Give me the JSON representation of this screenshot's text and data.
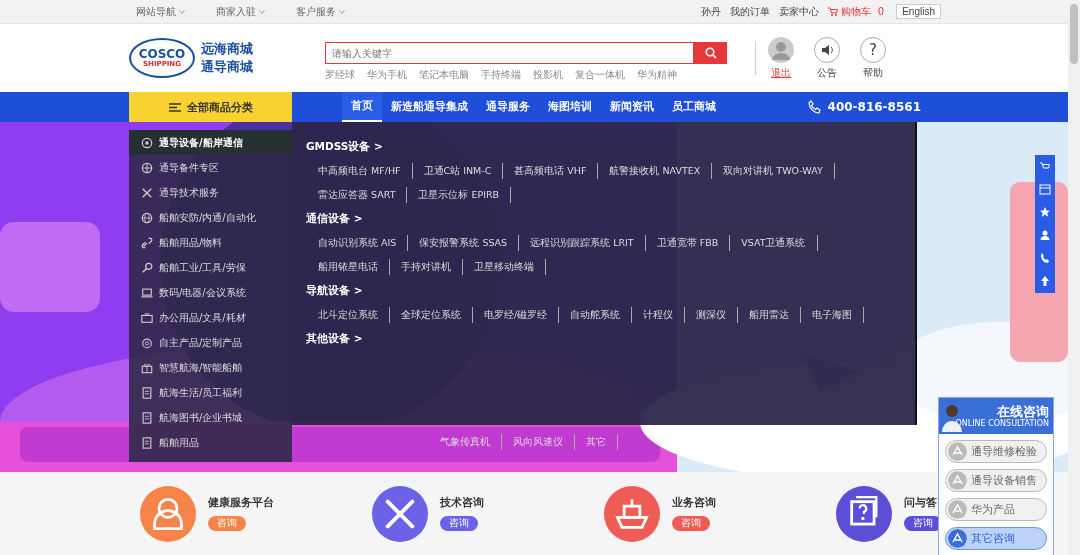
{
  "top_bar": {
    "left_links": [
      {
        "label": "网站导航"
      },
      {
        "label": "商家入驻"
      },
      {
        "label": "客户服务"
      }
    ],
    "right_links": [
      {
        "label": "孙丹"
      },
      {
        "label": "我的订单"
      },
      {
        "label": "卖家中心"
      }
    ],
    "cart": {
      "label": "购物车",
      "count": "0"
    },
    "language": "English"
  },
  "header": {
    "logo": {
      "mark_top": "COSCO",
      "mark_bottom": "SHIPPING",
      "name_line1": "远海商城",
      "name_line2": "通导商城"
    },
    "search": {
      "placeholder": "请输入关键字"
    },
    "hot_keywords": [
      "罗经球",
      "华为手机",
      "笔记本电脑",
      "手持终端",
      "投影机",
      "复合一体机",
      "华为精神"
    ],
    "user_actions": [
      {
        "kind": "avatar",
        "label": "退出"
      },
      {
        "kind": "speaker",
        "label": "公告"
      },
      {
        "kind": "help",
        "label": "帮助",
        "glyph": "?"
      }
    ]
  },
  "nav": {
    "all_categories": "全部商品分类",
    "links": [
      {
        "label": "首页",
        "selected": true
      },
      {
        "label": "新造船通导集成",
        "selected": false
      },
      {
        "label": "通导服务",
        "selected": false
      },
      {
        "label": "海图培训",
        "selected": false
      },
      {
        "label": "新闻资讯",
        "selected": false
      },
      {
        "label": "员工商城",
        "selected": false
      }
    ],
    "phone": "400-816-8561"
  },
  "categories": [
    {
      "label": "通导设备/船岸通信",
      "selected": true
    },
    {
      "label": "通导备件专区",
      "selected": false
    },
    {
      "label": "通导技术服务",
      "selected": false
    },
    {
      "label": "船舶安防/内通/自动化",
      "selected": false
    },
    {
      "label": "船舶用品/物料",
      "selected": false
    },
    {
      "label": "船舶工业/工具/劳保",
      "selected": false
    },
    {
      "label": "数码/电器/会议系统",
      "selected": false
    },
    {
      "label": "办公用品/文具/耗材",
      "selected": false
    },
    {
      "label": "自主产品/定制产品",
      "selected": false
    },
    {
      "label": "智慧航海/智能船舶",
      "selected": false
    },
    {
      "label": "航海生活/员工福利",
      "selected": false
    },
    {
      "label": "航海图书/企业书城",
      "selected": false
    },
    {
      "label": "船舶用品",
      "selected": false
    }
  ],
  "subcategories": [
    {
      "title": "GMDSS设备 >",
      "items": [
        "中高频电台 MF/HF",
        "卫通C站 INM-C",
        "甚高频电话 VHF",
        "航警接收机 NAVTEX",
        "双向对讲机 TWO-WAY",
        "雷达应答器 SART",
        "卫星示位标 EPIRB"
      ]
    },
    {
      "title": "通信设备 >",
      "items": [
        "自动识别系统 AIS",
        "保安报警系统 SSAS",
        "远程识别跟踪系统 LRIT",
        "卫通宽带 FBB",
        "VSAT卫通系统",
        "船用铱星电话",
        "手持对讲机",
        "卫星移动终端"
      ]
    },
    {
      "title": "导航设备 >",
      "items": [
        "北斗定位系统",
        "全球定位系统",
        "电罗经/磁罗经",
        "自动舵系统",
        "计程仪",
        "测深仪",
        "船用雷达",
        "电子海图"
      ]
    },
    {
      "title": "其他设备 >",
      "items": [
        "气象传真机",
        "风向风速仪",
        "其它"
      ]
    }
  ],
  "services": [
    {
      "title": "健康服务平台",
      "button": "咨询",
      "color": "#f5834a"
    },
    {
      "title": "技术咨询",
      "button": "咨询",
      "color": "#6a63e8"
    },
    {
      "title": "业务咨询",
      "button": "咨询",
      "color": "#ef5b55"
    },
    {
      "title": "问与答",
      "button": "咨询",
      "color": "#5b4fd8"
    }
  ],
  "consult_widget": {
    "title": "在线咨询",
    "subtitle": "ONLINE CONSULTATION",
    "items": [
      {
        "label": "通导维修检验",
        "selected": false
      },
      {
        "label": "通导设备销售",
        "selected": false
      },
      {
        "label": "华为产品",
        "selected": false
      },
      {
        "label": "其它咨询",
        "selected": true
      }
    ]
  }
}
